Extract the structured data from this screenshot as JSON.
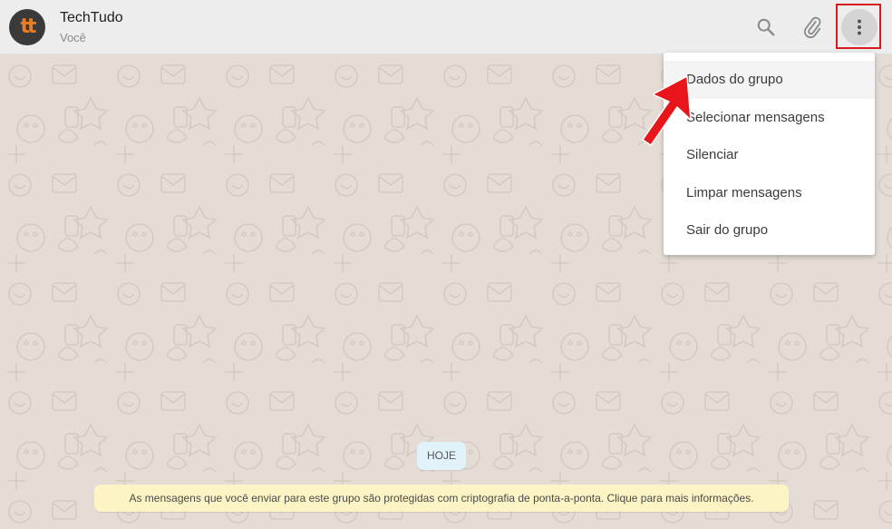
{
  "header": {
    "title": "TechTudo",
    "subtitle": "Você",
    "avatar_text": "tt",
    "icons": [
      "search-icon",
      "paperclip-icon",
      "more-vert-icon"
    ]
  },
  "menu": {
    "items": [
      {
        "label": "Dados do grupo"
      },
      {
        "label": "Selecionar mensagens"
      },
      {
        "label": "Silenciar"
      },
      {
        "label": "Limpar mensagens"
      },
      {
        "label": "Sair do grupo"
      }
    ]
  },
  "chat": {
    "date_label": "HOJE",
    "notice": "As mensagens que você enviar para este grupo são protegidas com criptografia de ponta-a-ponta. Clique para mais informações."
  },
  "colors": {
    "header_bg": "#ededed",
    "wallpaper": "#e5ddd5",
    "highlight": "#d8191f",
    "arrow": "#e8151b",
    "notice_bg": "#fdf4c5",
    "chip_bg": "#e1f2fa"
  }
}
